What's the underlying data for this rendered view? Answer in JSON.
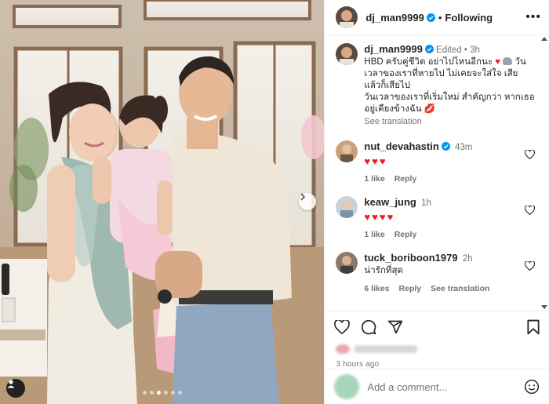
{
  "post": {
    "username": "dj_man9999",
    "follow_status": "Following",
    "more_label": "•••",
    "separator": "•"
  },
  "caption": {
    "username": "dj_man9999",
    "edited": "Edited",
    "time": "3h",
    "line1": "HBD ครับคู่ชีวิต อย่าไปไหนอีกนะ ",
    "line1_end": " วัน",
    "line2": "เวลาของเราที่หายไป ไม่เคยจะใส่ใจ เสีย",
    "line3": "แล้วก็เสียไป",
    "line4": "วันเวลาของเราที่เริ่มใหม่ สำคัญกว่า หากเธอ",
    "line5": "อยู่เคียงข้างฉัน",
    "see_translation": "See translation"
  },
  "comments": [
    {
      "username": "nut_devahastin",
      "verified": true,
      "time": "43m",
      "hearts": 3,
      "likes": "1 like",
      "reply": "Reply",
      "avatar_color": "#b08a6a"
    },
    {
      "username": "keaw_jung",
      "verified": false,
      "time": "1h",
      "hearts": 4,
      "likes": "1 like",
      "reply": "Reply",
      "avatar_color": "#9cb0c4"
    },
    {
      "username": "tuck_boriboon1979",
      "verified": false,
      "time": "2h",
      "text": "น่ารักที่สุด",
      "likes": "6 likes",
      "reply": "Reply",
      "see_translation": "See translation",
      "avatar_color": "#7a6a5a"
    }
  ],
  "footer": {
    "ago": "3 hours ago",
    "add_comment_placeholder": "Add a comment..."
  },
  "colors": {
    "verified": "#0095f6",
    "heart": "#ed1c24"
  },
  "carousel": {
    "total": 6,
    "current": 3
  }
}
